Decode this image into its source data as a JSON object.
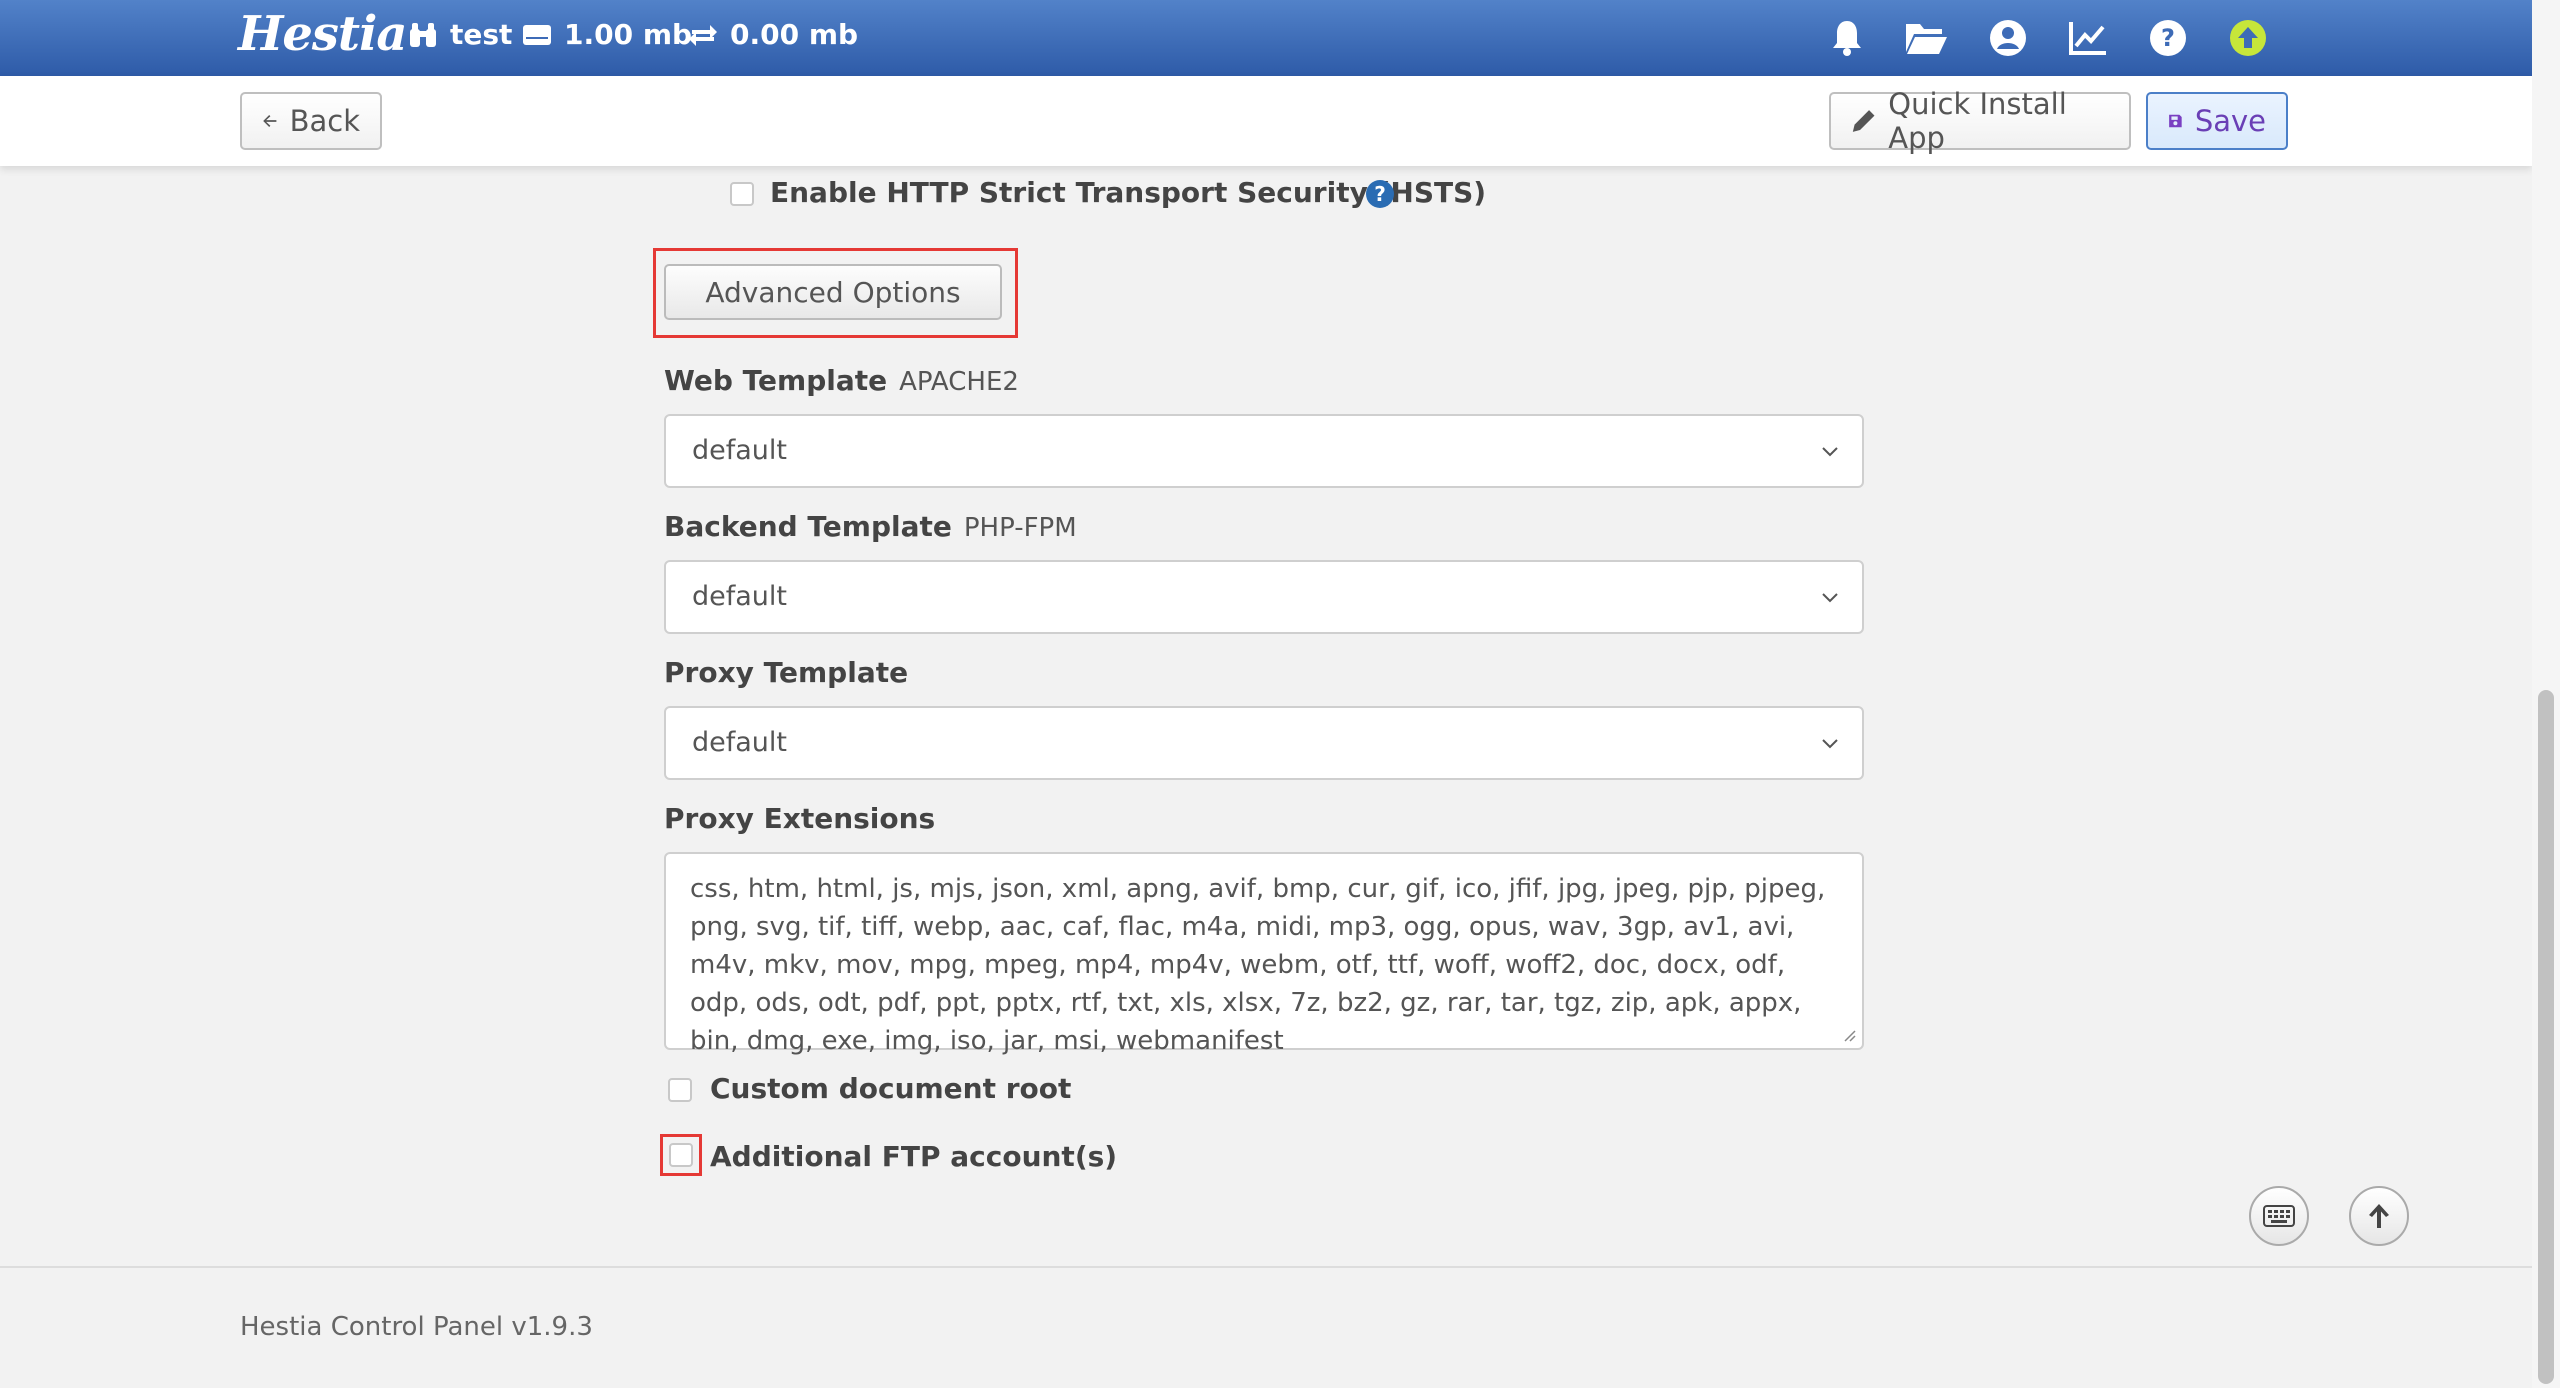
{
  "header": {
    "logo": "Hestia",
    "user": "test",
    "disk": "1.00 mb",
    "bandwidth": "0.00 mb",
    "icons": [
      "bell-icon",
      "folder-icon",
      "user-icon",
      "chart-icon",
      "help-icon",
      "update-icon"
    ]
  },
  "toolbar": {
    "back_label": "Back",
    "quick_install_label": "Quick Install App",
    "save_label": "Save"
  },
  "form": {
    "hsts_label": "Enable HTTP Strict Transport Security (HSTS)",
    "help_glyph": "?",
    "advanced_label": "Advanced Options",
    "web_template": {
      "label": "Web Template",
      "sub": "APACHE2",
      "value": "default"
    },
    "backend_template": {
      "label": "Backend Template",
      "sub": "PHP-FPM",
      "value": "default"
    },
    "proxy_template": {
      "label": "Proxy Template",
      "value": "default"
    },
    "proxy_extensions": {
      "label": "Proxy Extensions",
      "value": "css, htm, html, js, mjs, json, xml, apng, avif, bmp, cur, gif, ico, jfif, jpg, jpeg, pjp, pjpeg, png, svg, tif, tiff, webp, aac, caf, flac, m4a, midi, mp3, ogg, opus, wav, 3gp, av1, avi, m4v, mkv, mov, mpg, mpeg, mp4, mp4v, webm, otf, ttf, woff, woff2, doc, docx, odf, odp, ods, odt, pdf, ppt, pptx, rtf, txt, xls, xlsx, 7z, bz2, gz, rar, tar, tgz, zip, apk, appx, bin, dmg, exe, img, iso, jar, msi, webmanifest"
    },
    "custom_docroot_label": "Custom document root",
    "ftp_label": "Additional FTP account(s)"
  },
  "footer": {
    "text": "Hestia Control Panel v1.9.3"
  },
  "colors": {
    "header_top": "#5282c9",
    "header_bottom": "#2e5ba8",
    "highlight": "#e53935",
    "update": "#c6e63a"
  }
}
